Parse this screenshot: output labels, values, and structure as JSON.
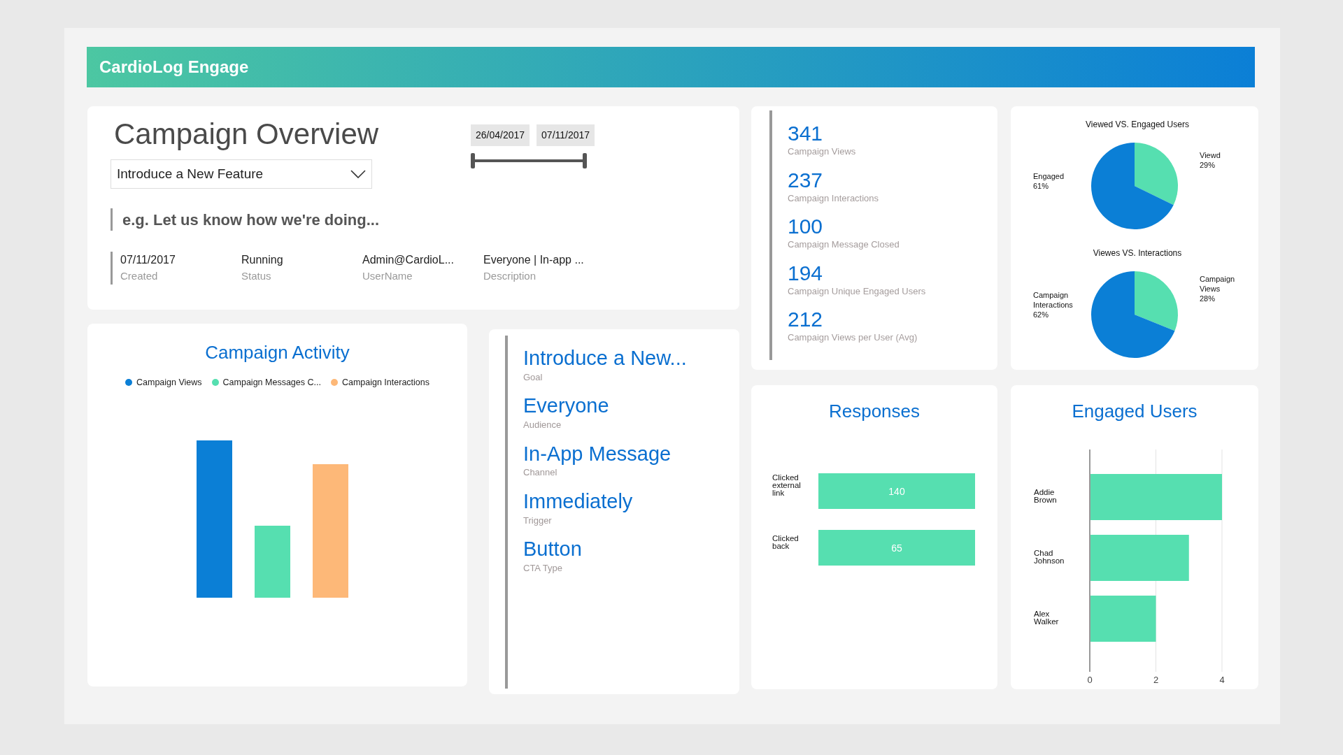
{
  "header": {
    "title": "CardioLog Engage"
  },
  "overview": {
    "title": "Campaign Overview",
    "campaign_select": {
      "value": "Introduce a New Feature"
    },
    "date_range": {
      "start": "26/04/2017",
      "end": "07/11/2017",
      "level": 1
    },
    "feedback": {
      "placeholder": "e.g. Let us know how we're doing..."
    },
    "fields": [
      {
        "value": "07/11/2017",
        "label": "Created"
      },
      {
        "value": "Running",
        "label": "Status"
      },
      {
        "value": "Admin@CardioL...",
        "label": "UserName"
      },
      {
        "value": "Everyone | In-app ...",
        "label": "Description"
      }
    ]
  },
  "stats": [
    {
      "value": "341",
      "label": "Campaign Views"
    },
    {
      "value": "237",
      "label": "Campaign Interactions"
    },
    {
      "value": "100",
      "label": "Campaign Message Closed"
    },
    {
      "value": "194",
      "label": "Campaign Unique Engaged Users"
    },
    {
      "value": "212",
      "label": "Campaign Views per User (Avg)"
    }
  ],
  "pies": [
    {
      "chart_data": {
        "type": "pie",
        "title": "Viewed VS. Engaged Users",
        "categories": [
          "Viewd",
          "Engaged"
        ],
        "values": [
          29,
          61
        ],
        "value_labels": [
          "29%",
          "61%"
        ]
      }
    },
    {
      "chart_data": {
        "type": "pie",
        "title": "Viewes VS. Interactions",
        "categories": [
          "Campaign Views",
          "Campaign Interactions"
        ],
        "values": [
          28,
          62
        ],
        "value_labels": [
          "28%",
          "62%"
        ]
      }
    }
  ],
  "activity": {
    "title": "Campaign Activity",
    "legend": [
      {
        "label": "Campaign Views",
        "color": "#0b7fd6"
      },
      {
        "label": "Campaign Messages C...",
        "color": "#56dfb0"
      },
      {
        "label": "Campaign Interactions",
        "color": "#fdb878"
      }
    ]
  },
  "details": [
    {
      "value": "Introduce a New...",
      "label": "Goal"
    },
    {
      "value": "Everyone",
      "label": "Audience"
    },
    {
      "value": "In-App Message",
      "label": "Channel"
    },
    {
      "value": "Immediately",
      "label": "Trigger"
    },
    {
      "value": "Button",
      "label": "CTA Type"
    }
  ],
  "responses": {
    "title": "Responses",
    "items": [
      {
        "label": "Clicked external link",
        "value": "140"
      },
      {
        "label": "Clicked back",
        "value": "65"
      }
    ]
  },
  "engaged_users": {
    "chart_data": {
      "type": "bar",
      "orientation": "horizontal",
      "title": "Engaged Users",
      "categories": [
        "Addie Brown",
        "Chad Johnson",
        "Alex Walker"
      ],
      "values": [
        4,
        3,
        2
      ],
      "xlim": [
        0,
        4
      ],
      "xticks": [
        0,
        2,
        4
      ]
    }
  }
}
